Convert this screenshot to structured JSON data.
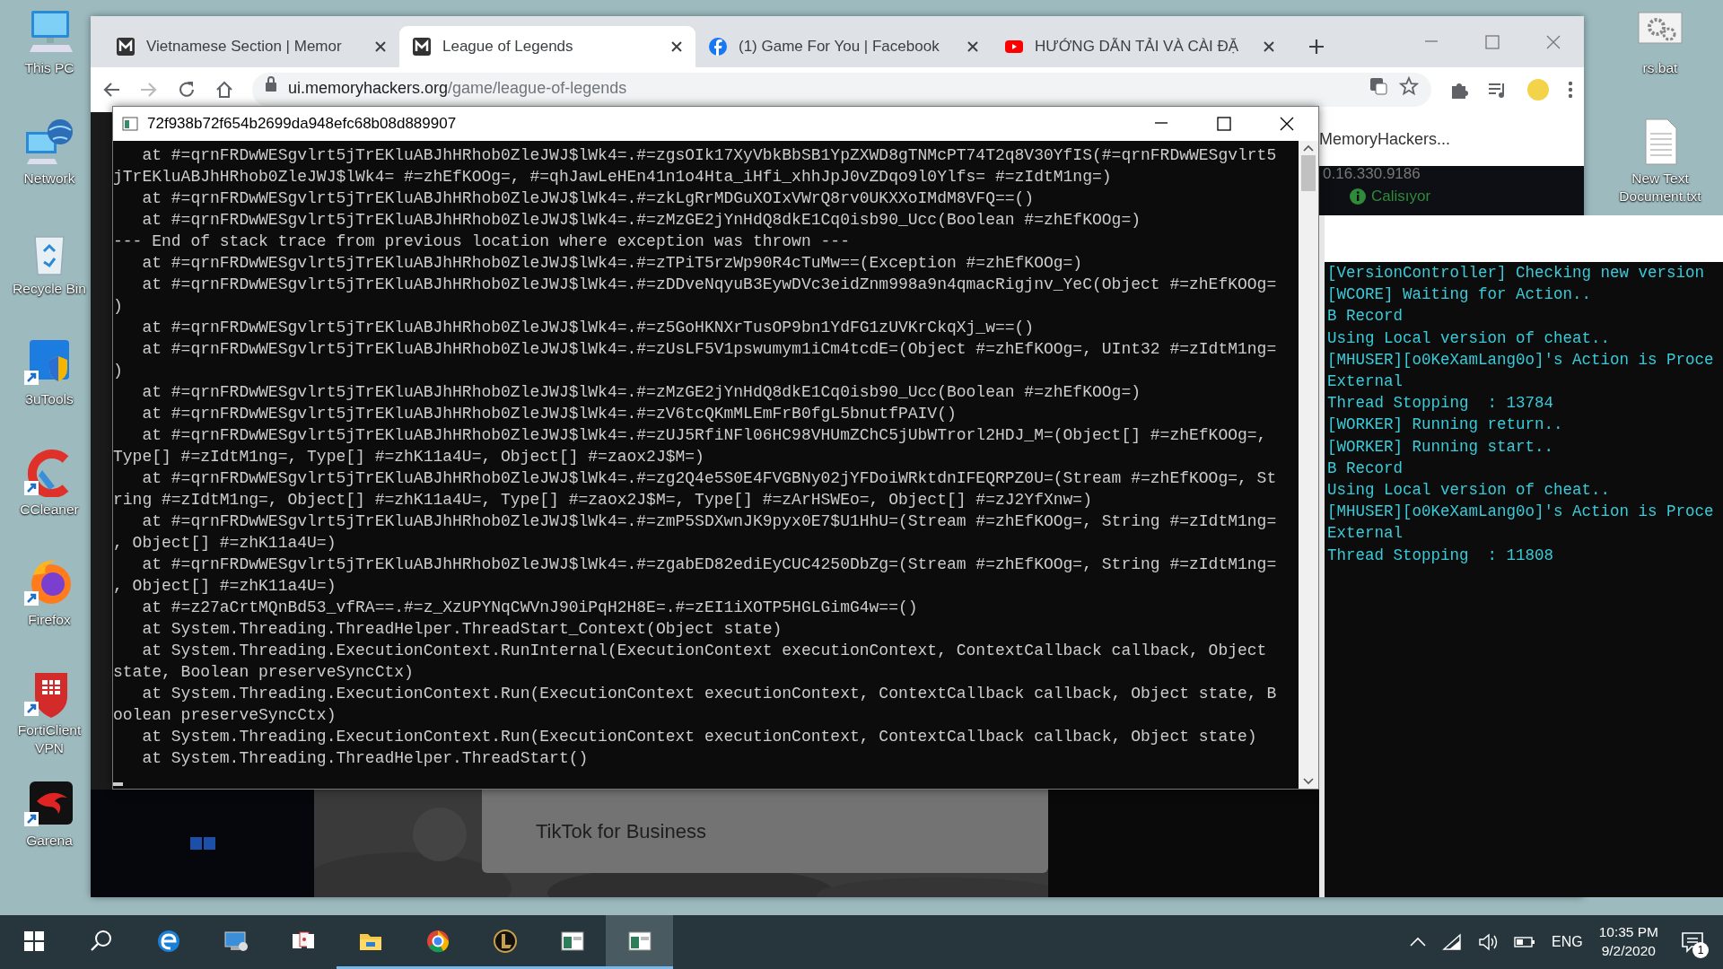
{
  "desktop_icons_left": [
    {
      "label": "This PC"
    },
    {
      "label": "Network"
    },
    {
      "label": "Recycle Bin"
    },
    {
      "label": "3uTools"
    },
    {
      "label": "CCleaner"
    },
    {
      "label": "Firefox"
    },
    {
      "label": "FortiClient VPN"
    },
    {
      "label": "Garena"
    }
  ],
  "desktop_icons_right": [
    {
      "label": "rs.bat"
    },
    {
      "label": "New Text Document.txt"
    }
  ],
  "browser": {
    "tabs": [
      {
        "title": "Vietnamese Section | Memor",
        "selected": false
      },
      {
        "title": "League of Legends",
        "selected": true
      },
      {
        "title": "(1) Game For You | Facebook",
        "selected": false
      },
      {
        "title": "HƯỚNG DẪN TẢI VÀ CÀI ĐẶ",
        "selected": false
      }
    ],
    "address_host": "ui.memoryhackers.org",
    "address_path": "/game/league-of-legends",
    "page": {
      "site_link": "MemoryHackers...",
      "version": "0.16.330.9186",
      "status": "Calisıyor",
      "card": "TikTok for Business"
    }
  },
  "console": {
    "title": "72f938b72f654b2699da948efc68b08d889907",
    "lines": [
      "   at #=qrnFRDwWESgvlrt5jTrEKluABJhHRhob0ZleJWJ$lWk4=.#=zgsOIk17XyVbkBbSB1YpZXWD8gTNMcPT74T2q8V30YfIS(#=qrnFRDwWESgvlrt5",
      "jTrEKluABJhHRhob0ZleJWJ$lWk4= #=zhEfKOOg=, #=qhJawLeHEn41n1o4Hta_iHfi_xhhJpJ0vZDqo9l0Ylfs= #=zIdtM1ng=)",
      "   at #=qrnFRDwWESgvlrt5jTrEKluABJhHRhob0ZleJWJ$lWk4=.#=zkLgRrMDGuXOIxVWrQ8rv0UKXXoIMdM8VFQ==()",
      "   at #=qrnFRDwWESgvlrt5jTrEKluABJhHRhob0ZleJWJ$lWk4=.#=zMzGE2jYnHdQ8dkE1Cq0isb90_Ucc(Boolean #=zhEfKOOg=)",
      "--- End of stack trace from previous location where exception was thrown ---",
      "   at #=qrnFRDwWESgvlrt5jTrEKluABJhHRhob0ZleJWJ$lWk4=.#=zTPiT5rzWp90R4cTuMw==(Exception #=zhEfKOOg=)",
      "   at #=qrnFRDwWESgvlrt5jTrEKluABJhHRhob0ZleJWJ$lWk4=.#=zDDveNqyuB3EywDVc3eidZnm998a9n4qmacRigjnv_YeC(Object #=zhEfKOOg=",
      ")",
      "   at #=qrnFRDwWESgvlrt5jTrEKluABJhHRhob0ZleJWJ$lWk4=.#=z5GoHKNXrTusOP9bn1YdFG1zUVKrCkqXj_w==()",
      "   at #=qrnFRDwWESgvlrt5jTrEKluABJhHRhob0ZleJWJ$lWk4=.#=zUsLF5V1pswumym1iCm4tcdE=(Object #=zhEfKOOg=, UInt32 #=zIdtM1ng=",
      ")",
      "   at #=qrnFRDwWESgvlrt5jTrEKluABJhHRhob0ZleJWJ$lWk4=.#=zMzGE2jYnHdQ8dkE1Cq0isb90_Ucc(Boolean #=zhEfKOOg=)",
      "   at #=qrnFRDwWESgvlrt5jTrEKluABJhHRhob0ZleJWJ$lWk4=.#=zV6tcQKmMLEmFrB0fgL5bnutfPAIV()",
      "   at #=qrnFRDwWESgvlrt5jTrEKluABJhHRhob0ZleJWJ$lWk4=.#=zUJ5RfiNFl06HC98VHUmZChC5jUbWTrorl2HDJ_M=(Object[] #=zhEfKOOg=,",
      "Type[] #=zIdtM1ng=, Type[] #=zhK11a4U=, Object[] #=zaox2J$M=)",
      "   at #=qrnFRDwWESgvlrt5jTrEKluABJhHRhob0ZleJWJ$lWk4=.#=zg2Q4e5S0E4FVGBNy02jYFDoiWRktdnIFEQRPZ0U=(Stream #=zhEfKOOg=, St",
      "ring #=zIdtM1ng=, Object[] #=zhK11a4U=, Type[] #=zaox2J$M=, Type[] #=zArHSWEo=, Object[] #=zJ2YfXnw=)",
      "   at #=qrnFRDwWESgvlrt5jTrEKluABJhHRhob0ZleJWJ$lWk4=.#=zmP5SDXwnJK9pyx0E7$U1HhU=(Stream #=zhEfKOOg=, String #=zIdtM1ng=",
      ", Object[] #=zhK11a4U=)",
      "   at #=qrnFRDwWESgvlrt5jTrEKluABJhHRhob0ZleJWJ$lWk4=.#=zgabED82ediEyCUC4250DbZg=(Stream #=zhEfKOOg=, String #=zIdtM1ng=",
      ", Object[] #=zhK11a4U=)",
      "   at #=z27aCrtMQnBd53_vfRA==.#=z_XzUPYNqCWVnJ90iPqH2H8E=.#=zEI1iXOTP5HGLGimG4w==()",
      "   at System.Threading.ThreadHelper.ThreadStart_Context(Object state)",
      "   at System.Threading.ExecutionContext.RunInternal(ExecutionContext executionContext, ContextCallback callback, Object",
      "state, Boolean preserveSyncCtx)",
      "   at System.Threading.ExecutionContext.Run(ExecutionContext executionContext, ContextCallback callback, Object state, B",
      "oolean preserveSyncCtx)",
      "   at System.Threading.ExecutionContext.Run(ExecutionContext executionContext, ContextCallback callback, Object state)",
      "   at System.Threading.ThreadHelper.ThreadStart()"
    ]
  },
  "log_console": {
    "lines": [
      "[VersionController] Checking new version",
      "[WCORE] Waiting for Action..",
      "B Record",
      "Using Local version of cheat..",
      "[MHUSER][o0KeXamLang0o]'s Action is Proce",
      "External",
      "Thread Stopping  : 13784",
      "[WORKER] Running return..",
      "[WORKER] Running start..",
      "B Record",
      "Using Local version of cheat..",
      "[MHUSER][o0KeXamLang0o]'s Action is Proce",
      "External",
      "Thread Stopping  : 11808"
    ]
  },
  "taskbar": {
    "apps": [
      {
        "running": false,
        "selected": false
      },
      {
        "running": false,
        "selected": false
      },
      {
        "running": false,
        "selected": false
      },
      {
        "running": false,
        "selected": false
      },
      {
        "running": true,
        "selected": false
      },
      {
        "running": true,
        "selected": false
      },
      {
        "running": true,
        "selected": false
      },
      {
        "running": true,
        "selected": false
      },
      {
        "running": true,
        "selected": true
      }
    ],
    "language": "ENG",
    "time": "10:35 PM",
    "date": "9/2/2020",
    "notifications": "1"
  }
}
